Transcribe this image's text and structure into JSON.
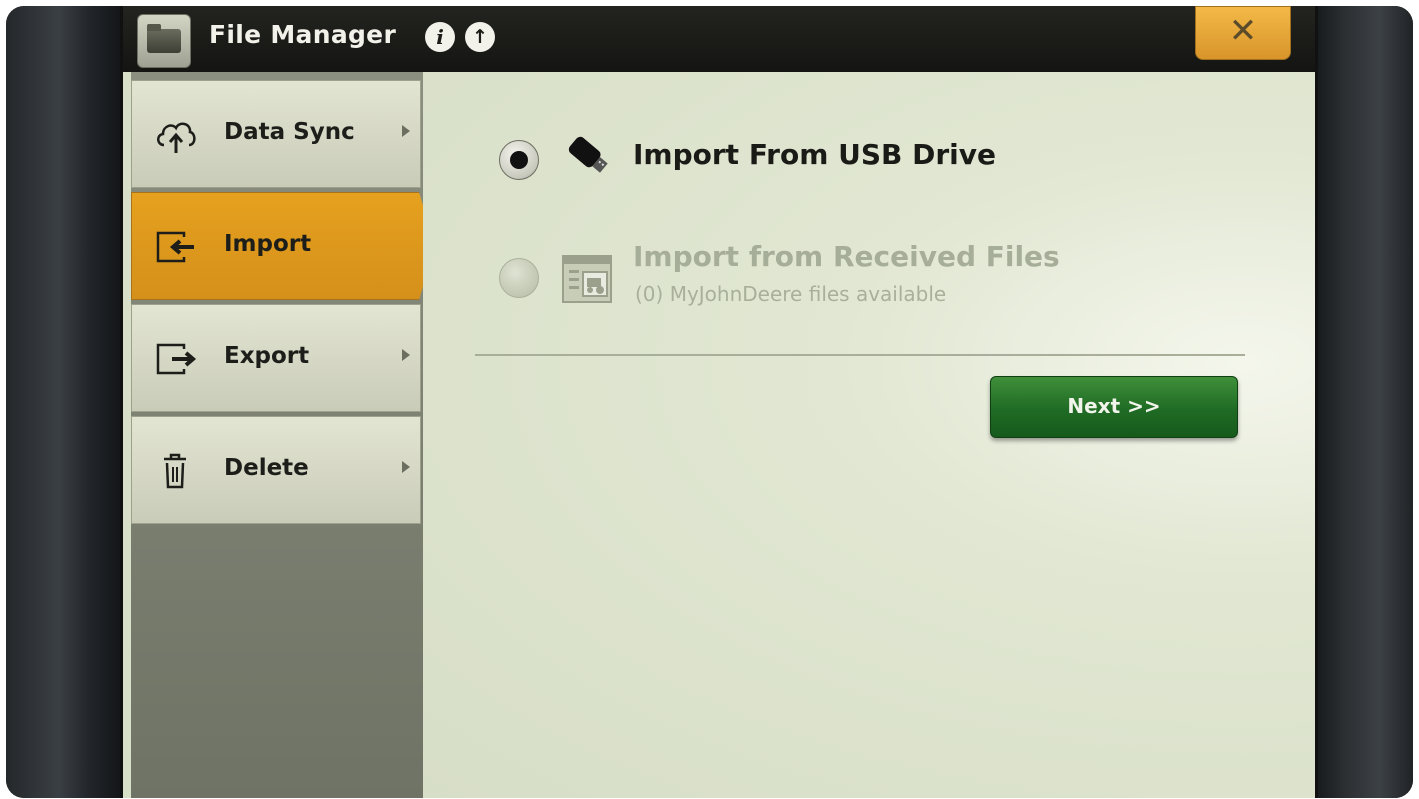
{
  "app": {
    "title": "File Manager",
    "info_glyph_1": "i",
    "info_glyph_2": "↑",
    "close_glyph": "✕"
  },
  "sidebar": {
    "items": [
      {
        "label": "Data Sync",
        "icon": "cloud-upload-icon",
        "active": false,
        "has_arrow": true
      },
      {
        "label": "Import",
        "icon": "import-icon",
        "active": true,
        "has_arrow": false
      },
      {
        "label": "Export",
        "icon": "export-icon",
        "active": false,
        "has_arrow": true
      },
      {
        "label": "Delete",
        "icon": "trash-icon",
        "active": false,
        "has_arrow": true
      }
    ]
  },
  "main": {
    "options": [
      {
        "label": "Import From USB Drive",
        "icon": "usb-drive-icon",
        "selected": true,
        "enabled": true
      },
      {
        "label": "Import from Received Files",
        "sublabel": "(0) MyJohnDeere files available",
        "icon": "received-files-icon",
        "selected": false,
        "enabled": false
      }
    ],
    "next_label": "Next >>"
  },
  "colors": {
    "accent_active": "#e6a11f",
    "next_button": "#1f6b24",
    "screen_bg": "#d9e0c8",
    "titlebar_bg": "#141512"
  }
}
